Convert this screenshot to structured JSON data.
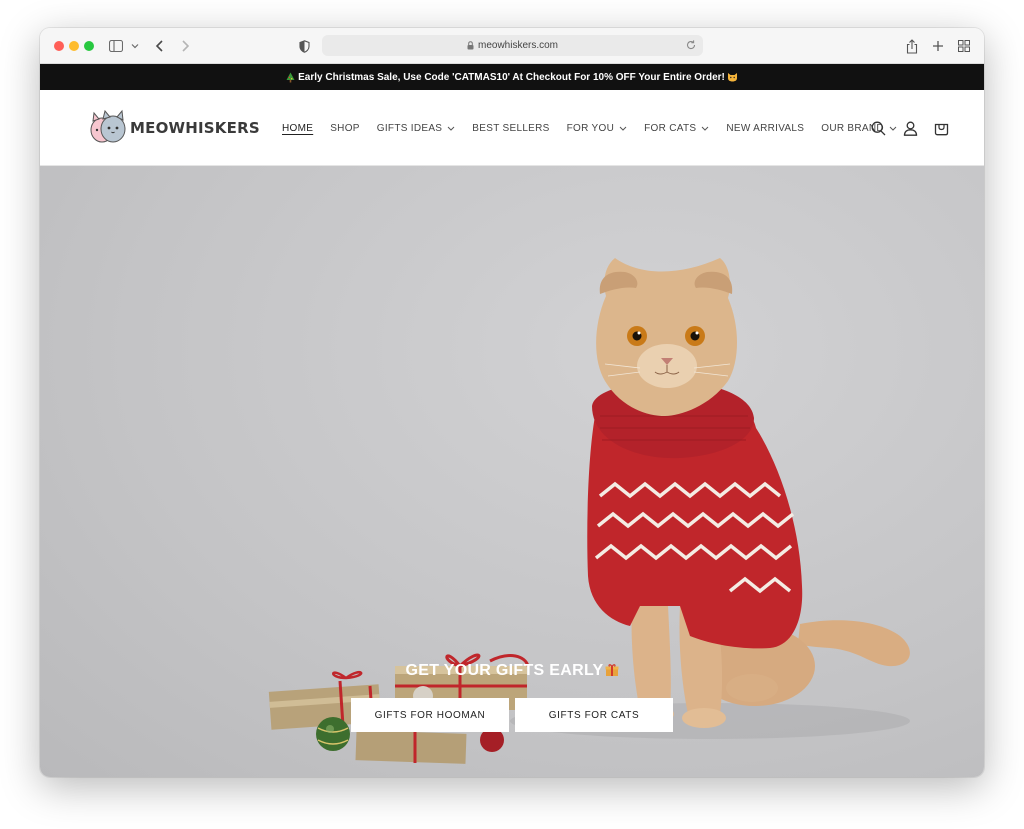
{
  "browser": {
    "url": "meowhiskers.com",
    "icons": [
      "sidebar-icon",
      "chevron-down-icon",
      "back-icon",
      "forward-icon",
      "shield-icon",
      "lock-icon",
      "reload-icon",
      "share-icon",
      "plus-icon",
      "tabs-grid-icon"
    ]
  },
  "announcement": {
    "text": "Early Christmas Sale, Use Code 'CATMAS10' At Checkout For 10% OFF Your Entire Order!",
    "leading_icon": "christmas-tree-icon",
    "trailing_icon": "cat-face-icon"
  },
  "header": {
    "brand": "MEOWHISKERS",
    "nav": [
      {
        "label": "HOME",
        "active": true,
        "dropdown": false
      },
      {
        "label": "SHOP",
        "active": false,
        "dropdown": false
      },
      {
        "label": "GIFTS IDEAS",
        "active": false,
        "dropdown": true
      },
      {
        "label": "BEST SELLERS",
        "active": false,
        "dropdown": false
      },
      {
        "label": "FOR YOU",
        "active": false,
        "dropdown": true
      },
      {
        "label": "FOR CATS",
        "active": false,
        "dropdown": true
      },
      {
        "label": "NEW ARRIVALS",
        "active": false,
        "dropdown": false
      },
      {
        "label": "OUR BRAND",
        "active": false,
        "dropdown": true
      }
    ],
    "icons": [
      "search-icon",
      "account-icon",
      "cart-icon"
    ]
  },
  "hero": {
    "title": "GET YOUR GIFTS EARLY",
    "title_icon": "gift-icon",
    "buttons": {
      "hooman": "GIFTS FOR HOOMAN",
      "cats": "GIFTS FOR CATS"
    }
  },
  "colors": {
    "announcement_bg": "#111111",
    "hero_bg": "#c6c6c8",
    "sweater_red": "#c0262b",
    "button_bg": "#ffffff"
  }
}
